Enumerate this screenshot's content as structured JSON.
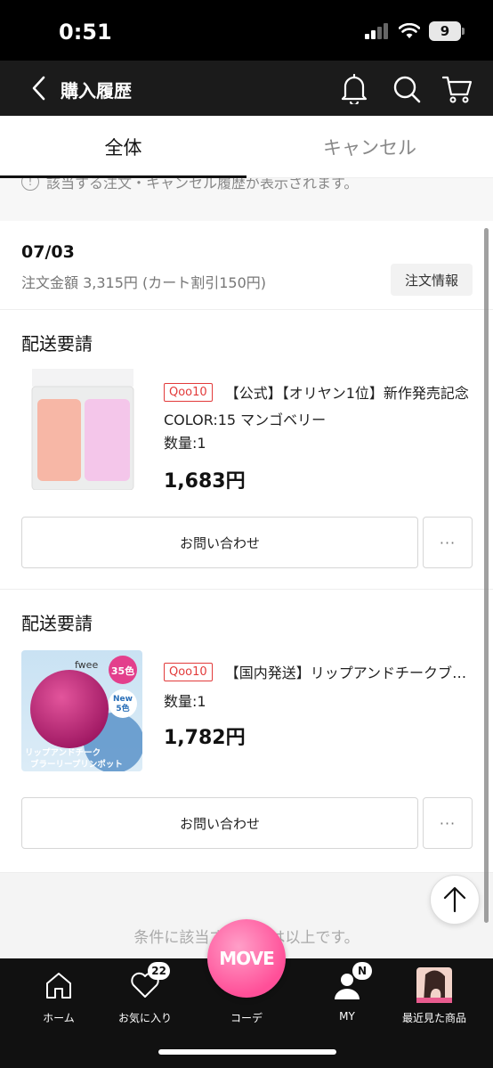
{
  "status_bar": {
    "time": "0:51",
    "battery": "9"
  },
  "nav": {
    "title": "購入履歴"
  },
  "tabs": [
    {
      "label": "全体",
      "active": true
    },
    {
      "label": "キャンセル",
      "active": false
    }
  ],
  "notice": {
    "text": "該当する注文・キャンセル履歴が表示されます。"
  },
  "order": {
    "date": "07/03",
    "amount_text": "注文金額 3,315円 (カート割引150円)",
    "info_button": "注文情報"
  },
  "shipments": [
    {
      "status": "配送要請",
      "badge": "Qoo10",
      "name": "【公式】【オリヤン1位】新作発売記念",
      "color": "COLOR:15 マンゴベリー",
      "quantity": "数量:1",
      "price": "1,683円",
      "inquiry_label": "お問い合わせ",
      "more_label": "···"
    },
    {
      "status": "配送要請",
      "badge": "Qoo10",
      "name": "【国内発送】リップアンドチークブラーリープリンポット",
      "quantity": "数量:1",
      "price": "1,782円",
      "inquiry_label": "お問い合わせ",
      "more_label": "···",
      "thumb_brand": "fwee",
      "thumb_badge1": "35色",
      "thumb_badge2_line1": "New",
      "thumb_badge2_line2": "5色",
      "thumb_caption1": "リップアンドチーク",
      "thumb_caption2": "ブラーリープリンポット"
    }
  ],
  "footer": {
    "end_text": "条件に該当する注文は以上です。"
  },
  "move_button": "MOVE",
  "tab_bar": [
    {
      "label": "ホーム"
    },
    {
      "label": "お気に入り",
      "badge": "22"
    },
    {
      "label": "コーデ"
    },
    {
      "label": "MY",
      "badge": "N"
    },
    {
      "label": "最近見た商品"
    }
  ],
  "colors": {
    "accent_pink": "#ff4f98",
    "qoo10_red": "#e23b3b",
    "nav_bg": "#1b1b1b"
  }
}
